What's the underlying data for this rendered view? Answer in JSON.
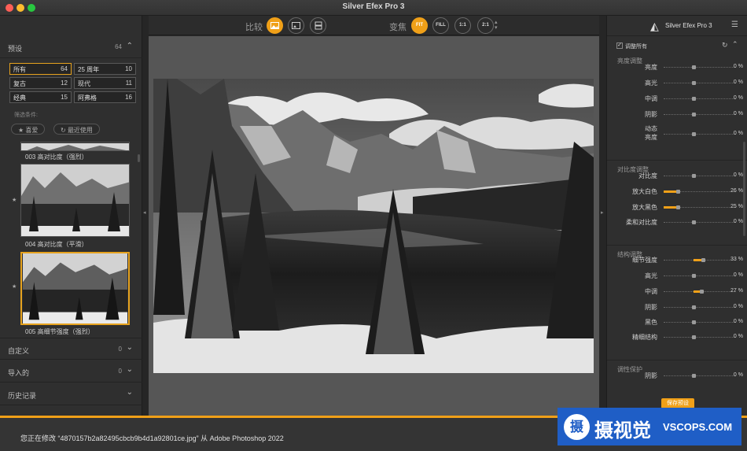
{
  "window": {
    "title": "Silver Efex Pro 3",
    "traffic_lights": [
      "#ff5f57",
      "#febc2e",
      "#28c840"
    ]
  },
  "left_panel": {
    "presets": {
      "label": "预设",
      "count": "64"
    },
    "preset_buttons": [
      {
        "label": "所有",
        "count": "64",
        "selected": true
      },
      {
        "label": "25 周年",
        "count": "10"
      },
      {
        "label": "复古",
        "count": "12"
      },
      {
        "label": "现代",
        "count": "11"
      },
      {
        "label": "经典",
        "count": "15"
      },
      {
        "label": "阿弗格",
        "count": "16"
      }
    ],
    "filter_label": "筛选条件:",
    "filter_chips": [
      {
        "icon": "star-icon",
        "label": "喜爱"
      },
      {
        "icon": "history-icon",
        "label": "最近使用"
      }
    ],
    "thumbs": [
      {
        "caption": "003 高对比度（强烈）"
      },
      {
        "caption": "004 高对比度（平滑）"
      },
      {
        "caption": "005 高细节强度（强烈）",
        "selected": true
      }
    ],
    "sections": [
      {
        "label": "自定义",
        "count": "0"
      },
      {
        "label": "导入的",
        "count": "0"
      },
      {
        "label": "历史记录",
        "count": ""
      }
    ]
  },
  "toolbar": {
    "compare_label": "比较",
    "zoom_label": "变焦",
    "zoom_buttons": [
      "FIT",
      "FILL",
      "1:1",
      "2:1"
    ]
  },
  "right_panel": {
    "brand": "Silver Efex Pro 3",
    "adjust_all": "调整所有",
    "groups": [
      {
        "title": "亮度调整",
        "sliders": [
          {
            "label": "亮度",
            "value": "0",
            "unit": "%",
            "pct": 0
          },
          {
            "label": "高光",
            "value": "0",
            "unit": "%",
            "pct": 0
          },
          {
            "label": "中调",
            "value": "0",
            "unit": "%",
            "pct": 0
          },
          {
            "label": "阴影",
            "value": "0",
            "unit": "%",
            "pct": 0
          },
          {
            "label": "动态",
            "label2": "亮度",
            "value": "0",
            "unit": "%",
            "pct": 0
          }
        ]
      },
      {
        "title": "对比度调整",
        "sliders": [
          {
            "label": "对比度",
            "value": "0",
            "unit": "%",
            "pct": 0
          },
          {
            "label": "放大白色",
            "value": "26",
            "unit": "%",
            "pct": 26
          },
          {
            "label": "放大黑色",
            "value": "25",
            "unit": "%",
            "pct": 25
          },
          {
            "label": "柔和对比度",
            "value": "0",
            "unit": "%",
            "pct": 0
          }
        ]
      },
      {
        "title": "结构调整",
        "sliders": [
          {
            "label": "细节强度",
            "value": "33",
            "unit": "%",
            "pct": 33
          },
          {
            "label": "高光",
            "value": "0",
            "unit": "%",
            "pct": 0
          },
          {
            "label": "中调",
            "value": "27",
            "unit": "%",
            "pct": 27
          },
          {
            "label": "阴影",
            "value": "0",
            "unit": "%",
            "pct": 0
          },
          {
            "label": "黑色",
            "value": "0",
            "unit": "%",
            "pct": 0
          },
          {
            "label": "精细结构",
            "value": "0",
            "unit": "%",
            "pct": 0
          }
        ]
      },
      {
        "title": "调性保护",
        "sliders": [
          {
            "label": "阴影",
            "value": "0",
            "unit": "%",
            "pct": 0
          }
        ]
      }
    ],
    "save_preset": "保存预设"
  },
  "status": {
    "text": "您正在修改 “4870157b2a82495cbcb9b4d1a92801ce.jpg” 从 Adobe Photoshop 2022"
  },
  "watermark": {
    "glyph": "摄",
    "text": "摄视觉",
    "site": "VSCOPS.COM"
  },
  "accent": "#f0a018"
}
